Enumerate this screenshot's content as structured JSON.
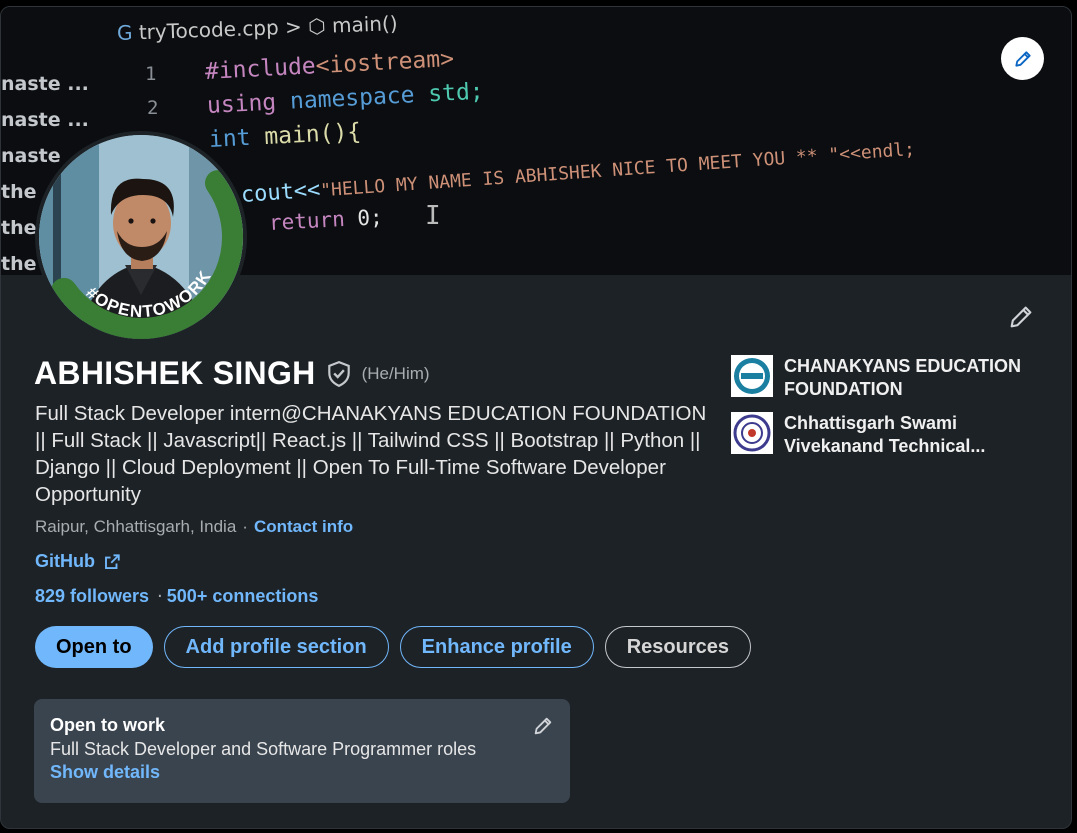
{
  "banner": {
    "breadcrumb_file": "tryTocode.cpp",
    "breadcrumb_sep": ">",
    "breadcrumb_symbol": "main()",
    "side_lines": [
      "naste ...",
      "naste ...",
      "naste",
      "the",
      "the",
      "the"
    ],
    "line_numbers": [
      "1",
      "2"
    ],
    "code": {
      "include_kw": "#include",
      "include_lib": "<iostream>",
      "using_kw": "using",
      "namespace_kw": "namespace",
      "std": "std;",
      "int_kw": "int",
      "main_fn": "main(){",
      "cout_kw": "cout<<",
      "cout_str": "\"HELLO MY NAME IS ABHISHEK  NICE TO MEET YOU ** \"<<endl;",
      "return_kw": "return",
      "return_val": "0;"
    },
    "cursor_glyph": "I"
  },
  "avatar": {
    "frame_text": "#OPENTOWORK",
    "frame_color": "#3a7d34"
  },
  "profile": {
    "name": "ABHISHEK SINGH",
    "pronouns": "(He/Him)",
    "headline": "Full Stack Developer intern@CHANAKYANS EDUCATION FOUNDATION || Full Stack || Javascript|| React.js || Tailwind CSS || Bootstrap || Python || Django || Cloud Deployment || Open To Full-Time Software Developer Opportunity",
    "location": "Raipur, Chhattisgarh, India",
    "location_sep": "·",
    "contact_info": "Contact info",
    "website": "GitHub",
    "followers": "829 followers",
    "connections_sep": "·",
    "connections": "500+ connections"
  },
  "actions": {
    "open_to": "Open to",
    "add_section": "Add profile section",
    "enhance": "Enhance profile",
    "resources": "Resources"
  },
  "open_to_work": {
    "title": "Open to work",
    "roles": "Full Stack Developer and Software Programmer roles",
    "show_details": "Show details"
  },
  "organizations": [
    {
      "name": "CHANAKYANS EDUCATION FOUNDATION"
    },
    {
      "name": "Chhattisgarh Swami Vivekanand Technical..."
    }
  ],
  "colors": {
    "accent": "#71b7fb",
    "card_bg": "#1d2226",
    "otw_box_bg": "#3a444f",
    "opentowork_green": "#3a7d34"
  },
  "icons": {
    "banner_edit": "pencil-icon",
    "intro_edit": "pencil-icon",
    "verified": "shield-check-icon",
    "external_link": "external-link-icon",
    "otw_edit": "pencil-icon"
  }
}
